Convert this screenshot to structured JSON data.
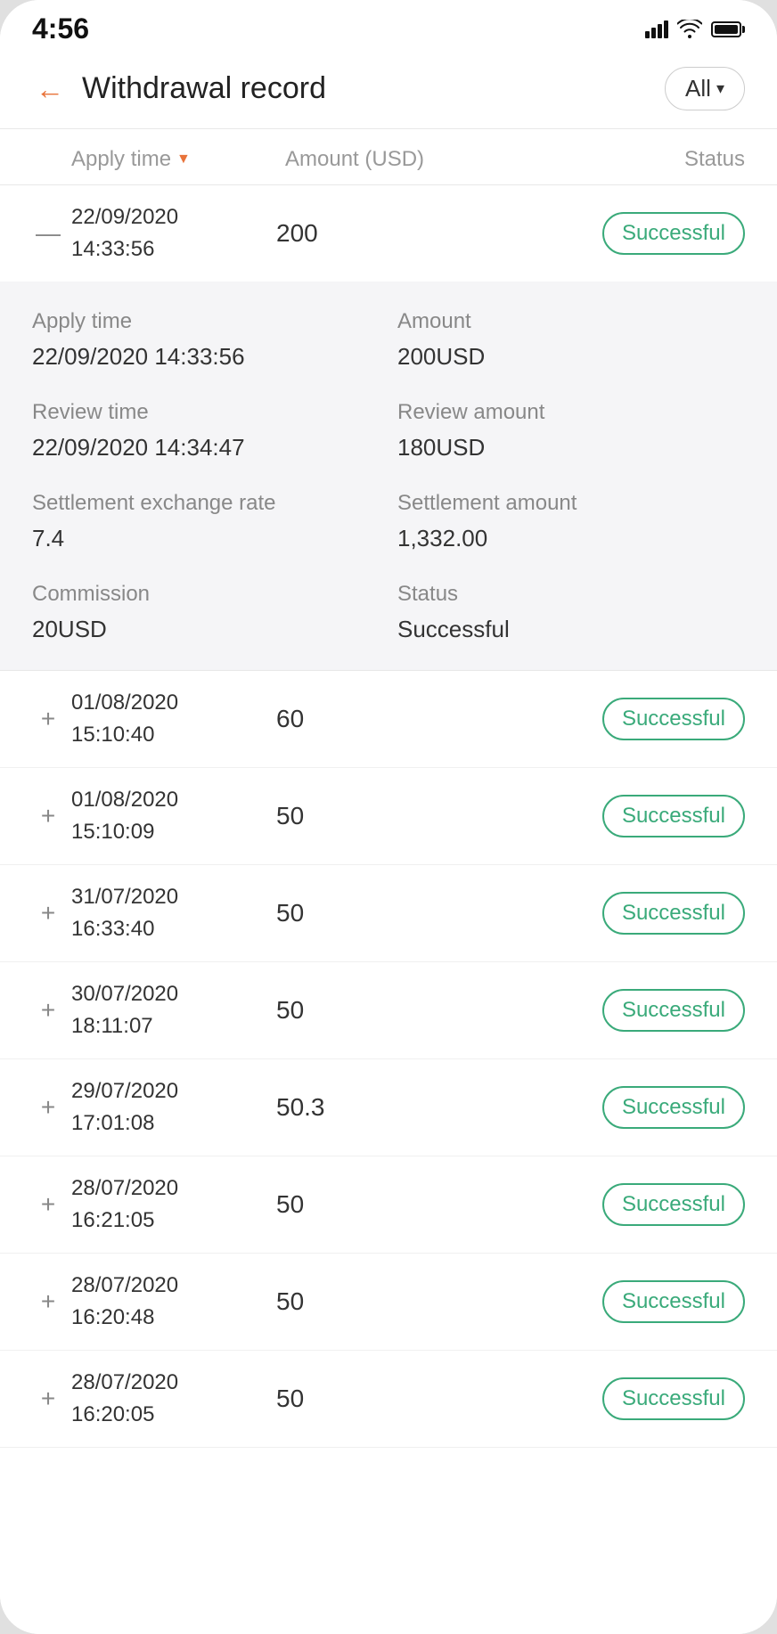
{
  "statusBar": {
    "time": "4:56",
    "signal": "signal-icon",
    "wifi": "wifi-icon",
    "battery": "battery-icon"
  },
  "header": {
    "backLabel": "←",
    "title": "Withdrawal record",
    "filterLabel": "All",
    "filterIcon": "▾"
  },
  "tableHeaders": {
    "timeLabel": "Apply time",
    "amountLabel": "Amount (USD)",
    "statusLabel": "Status"
  },
  "expandedRecord": {
    "applyTimeLabel": "Apply time",
    "applyTimeValue": "22/09/2020 14:33:56",
    "amountLabel": "Amount",
    "amountValue": "200USD",
    "reviewTimeLabel": "Review time",
    "reviewTimeValue": "22/09/2020 14:34:47",
    "reviewAmountLabel": "Review amount",
    "reviewAmountValue": "180USD",
    "settlementRateLabel": "Settlement exchange rate",
    "settlementRateValue": "7.4",
    "settlementAmountLabel": "Settlement amount",
    "settlementAmountValue": "1,332.00",
    "commissionLabel": "Commission",
    "commissionValue": "20USD",
    "statusLabel": "Status",
    "statusValue": "Successful"
  },
  "records": [
    {
      "id": 1,
      "expanded": true,
      "expandIcon": "—",
      "date": "22/09/2020",
      "time": "14:33:56",
      "amount": "200",
      "status": "Successful"
    },
    {
      "id": 2,
      "expanded": false,
      "expandIcon": "+",
      "date": "01/08/2020",
      "time": "15:10:40",
      "amount": "60",
      "status": "Successful"
    },
    {
      "id": 3,
      "expanded": false,
      "expandIcon": "+",
      "date": "01/08/2020",
      "time": "15:10:09",
      "amount": "50",
      "status": "Successful"
    },
    {
      "id": 4,
      "expanded": false,
      "expandIcon": "+",
      "date": "31/07/2020",
      "time": "16:33:40",
      "amount": "50",
      "status": "Successful"
    },
    {
      "id": 5,
      "expanded": false,
      "expandIcon": "+",
      "date": "30/07/2020",
      "time": "18:11:07",
      "amount": "50",
      "status": "Successful"
    },
    {
      "id": 6,
      "expanded": false,
      "expandIcon": "+",
      "date": "29/07/2020",
      "time": "17:01:08",
      "amount": "50.3",
      "status": "Successful"
    },
    {
      "id": 7,
      "expanded": false,
      "expandIcon": "+",
      "date": "28/07/2020",
      "time": "16:21:05",
      "amount": "50",
      "status": "Successful"
    },
    {
      "id": 8,
      "expanded": false,
      "expandIcon": "+",
      "date": "28/07/2020",
      "time": "16:20:48",
      "amount": "50",
      "status": "Successful"
    },
    {
      "id": 9,
      "expanded": false,
      "expandIcon": "+",
      "date": "28/07/2020",
      "time": "16:20:05",
      "amount": "50",
      "status": "Successful"
    }
  ]
}
